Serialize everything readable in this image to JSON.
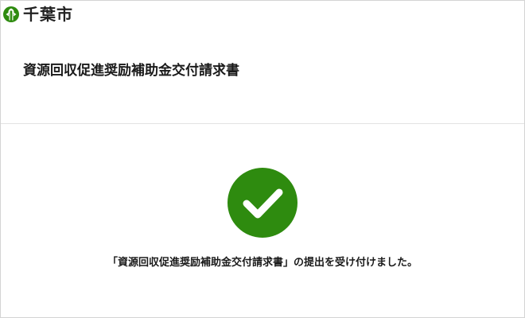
{
  "brand": {
    "name": "千葉市",
    "logo_icon": "chiba-city-emblem-icon",
    "logo_color": "#2e8b0f"
  },
  "form": {
    "title": "資源回収促進奨励補助金交付請求書"
  },
  "result": {
    "icon": "check-icon",
    "icon_color": "#2e8b0f",
    "message": "「資源回収促進奨励補助金交付請求書」の提出を受け付けました。"
  }
}
